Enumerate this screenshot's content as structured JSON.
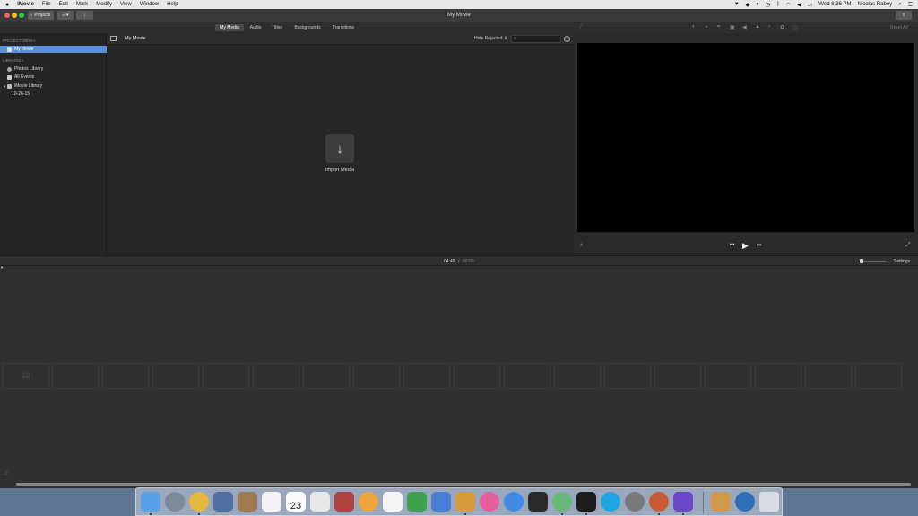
{
  "menubar": {
    "apple": "",
    "app": "iMovie",
    "items": [
      "File",
      "Edit",
      "Mark",
      "Modify",
      "View",
      "Window",
      "Help"
    ],
    "clock": "Wed 6:36 PM",
    "user": "Nicolas Raboy"
  },
  "toolbar": {
    "projects_label": "Projects",
    "window_title": "My Movie"
  },
  "tabs": [
    "My Media",
    "Audio",
    "Titles",
    "Backgrounds",
    "Transitions"
  ],
  "sidebar": {
    "project_media_header": "PROJECT MEDIA",
    "project_item": "My Movie",
    "libraries_header": "LIBRARIES",
    "libraries": [
      "Photos Library",
      "All Events",
      "iMovie Library"
    ],
    "event": "10-26-15"
  },
  "browser": {
    "title": "My Movie",
    "filter": "Hide Rejected",
    "import_label": "Import Media"
  },
  "viewer": {
    "reset_label": "Reset All"
  },
  "timeline": {
    "current_time": "04:49",
    "separator": "/",
    "total_time": "00:00",
    "settings_label": "Settings"
  },
  "dock": {
    "calendar_day": "23"
  }
}
